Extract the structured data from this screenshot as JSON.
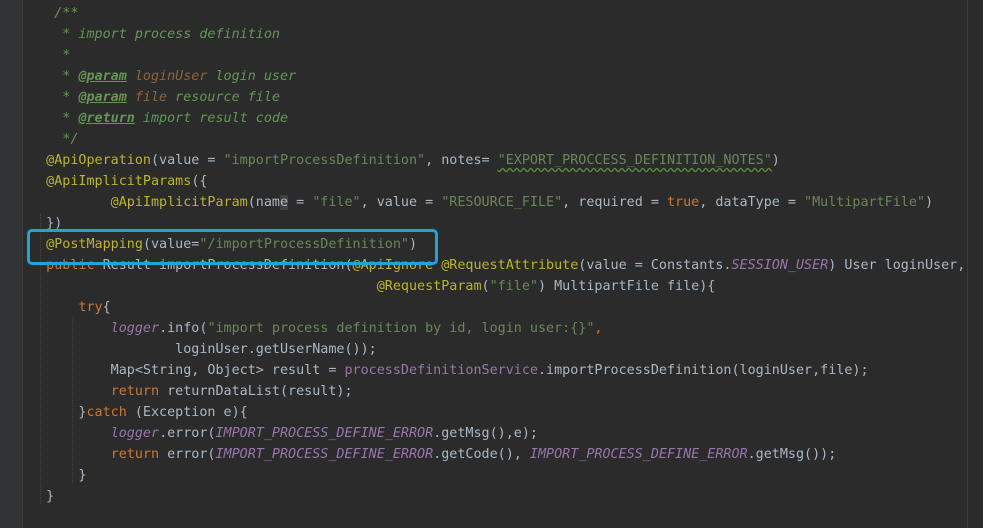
{
  "editor": {
    "lines": [
      [
        {
          "t": "    /**",
          "c": "c"
        }
      ],
      [
        {
          "t": "     * import process definition",
          "c": "c"
        }
      ],
      [
        {
          "t": "     *",
          "c": "c"
        }
      ],
      [
        {
          "t": "     * ",
          "c": "c"
        },
        {
          "t": "@param",
          "c": "ct"
        },
        {
          "t": " ",
          "c": "c"
        },
        {
          "t": "loginUser",
          "c": "cv"
        },
        {
          "t": " login user",
          "c": "c"
        }
      ],
      [
        {
          "t": "     * ",
          "c": "c"
        },
        {
          "t": "@param",
          "c": "ct"
        },
        {
          "t": " ",
          "c": "c"
        },
        {
          "t": "file",
          "c": "cv"
        },
        {
          "t": " resource file",
          "c": "c"
        }
      ],
      [
        {
          "t": "     * ",
          "c": "c"
        },
        {
          "t": "@return",
          "c": "ct"
        },
        {
          "t": " import result code",
          "c": "c"
        }
      ],
      [
        {
          "t": "     */",
          "c": "c"
        }
      ],
      [
        {
          "t": "   @ApiOperation",
          "c": "an"
        },
        {
          "t": "(value = ",
          "c": "pl"
        },
        {
          "t": "\"importProcessDefinition\"",
          "c": "st"
        },
        {
          "t": ", notes= ",
          "c": "pl"
        },
        {
          "t": "\"EXPORT_PROCCESS_DEFINITION_NOTES\"",
          "c": "st squig-part"
        },
        {
          "t": ")",
          "c": "pl"
        }
      ],
      [
        {
          "t": "   @ApiImplicitParams",
          "c": "an"
        },
        {
          "t": "({",
          "c": "pl"
        }
      ],
      [
        {
          "t": "           @ApiImplicitParam",
          "c": "an"
        },
        {
          "t": "(nam",
          "c": "pl"
        },
        {
          "t": "e",
          "c": "pl caret-sel"
        },
        {
          "t": " = ",
          "c": "pl"
        },
        {
          "t": "\"file\"",
          "c": "st"
        },
        {
          "t": ", value = ",
          "c": "pl"
        },
        {
          "t": "\"RESOURCE_FILE\"",
          "c": "st"
        },
        {
          "t": ", required = ",
          "c": "pl"
        },
        {
          "t": "true",
          "c": "kw"
        },
        {
          "t": ", dataType = ",
          "c": "pl"
        },
        {
          "t": "\"MultipartFile\"",
          "c": "st"
        },
        {
          "t": ")",
          "c": "pl"
        }
      ],
      [
        {
          "t": "   })",
          "c": "pl"
        }
      ],
      [
        {
          "t": "   @PostMapping",
          "c": "an"
        },
        {
          "t": "(value=",
          "c": "pl"
        },
        {
          "t": "\"/importProcessDefinition\"",
          "c": "st"
        },
        {
          "t": ")",
          "c": "pl"
        }
      ],
      [
        {
          "t": "   public",
          "c": "kw"
        },
        {
          "t": " Result importProcessDefinition(",
          "c": "pl"
        },
        {
          "t": "@ApiIgnore",
          "c": "an"
        },
        {
          "t": " ",
          "c": "pl"
        },
        {
          "t": "@RequestAttribute",
          "c": "an"
        },
        {
          "t": "(value = Constants.",
          "c": "pl"
        },
        {
          "t": "SESSION_USER",
          "c": "fd"
        },
        {
          "t": ") User loginUser,",
          "c": "pl"
        }
      ],
      [
        {
          "t": "                                            ",
          "c": "pl"
        },
        {
          "t": "@RequestParam",
          "c": "an"
        },
        {
          "t": "(",
          "c": "pl"
        },
        {
          "t": "\"file\"",
          "c": "st"
        },
        {
          "t": ") MultipartFile file){",
          "c": "pl"
        }
      ],
      [
        {
          "t": "       ",
          "c": "pl"
        },
        {
          "t": "try",
          "c": "kw"
        },
        {
          "t": "{",
          "c": "pl"
        }
      ],
      [
        {
          "t": "           ",
          "c": "pl"
        },
        {
          "t": "logger",
          "c": "fd"
        },
        {
          "t": ".info(",
          "c": "pl"
        },
        {
          "t": "\"import process definition by id, login user:{}\"",
          "c": "st"
        },
        {
          "t": ",",
          "c": "kw"
        }
      ],
      [
        {
          "t": "                   loginUser.getUserName());",
          "c": "pl"
        }
      ],
      [
        {
          "t": "           Map<String, Object> result = ",
          "c": "pl"
        },
        {
          "t": "processDefinitionService",
          "c": "fd2"
        },
        {
          "t": ".importProcessDefinition(loginUser,file);",
          "c": "pl"
        }
      ],
      [
        {
          "t": "           ",
          "c": "pl"
        },
        {
          "t": "return",
          "c": "kw"
        },
        {
          "t": " returnDataList(result);",
          "c": "pl"
        }
      ],
      [
        {
          "t": "       }",
          "c": "pl"
        },
        {
          "t": "catch",
          "c": "kw"
        },
        {
          "t": " (Exception e){",
          "c": "pl"
        }
      ],
      [
        {
          "t": "           ",
          "c": "pl"
        },
        {
          "t": "logger",
          "c": "fd"
        },
        {
          "t": ".error(",
          "c": "pl"
        },
        {
          "t": "IMPORT_PROCESS_DEFINE_ERROR",
          "c": "fd"
        },
        {
          "t": ".getMsg(),e);",
          "c": "pl"
        }
      ],
      [
        {
          "t": "           ",
          "c": "pl"
        },
        {
          "t": "return",
          "c": "kw"
        },
        {
          "t": " error(",
          "c": "pl"
        },
        {
          "t": "IMPORT_PROCESS_DEFINE_ERROR",
          "c": "fd"
        },
        {
          "t": ".getCode(), ",
          "c": "pl"
        },
        {
          "t": "IMPORT_PROCESS_DEFINE_ERROR",
          "c": "fd"
        },
        {
          "t": ".getMsg());",
          "c": "pl"
        }
      ],
      [
        {
          "t": "       }",
          "c": "pl"
        }
      ],
      [
        {
          "t": "   }",
          "c": "pl"
        }
      ]
    ]
  },
  "annotation": {
    "highlight_color": "#1aa7d8",
    "highlighted_line": "@PostMapping(value=\"/importProcessDefinition\")"
  },
  "colors": {
    "background": "#2b2b2b",
    "comment": "#629755",
    "annotation": "#bbb529",
    "string": "#6a8759",
    "keyword": "#cc7832",
    "field": "#9876aa",
    "plain": "#a9b7c6"
  }
}
